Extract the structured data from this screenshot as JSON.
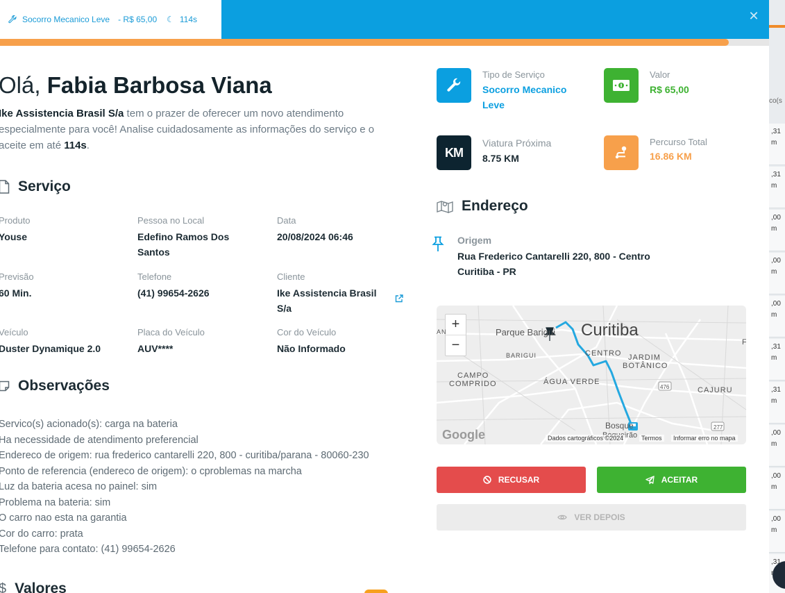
{
  "colors": {
    "primary": "#0b9fe0",
    "accent_orange": "#f7a04b",
    "success": "#3eb232",
    "danger": "#e44c4c",
    "dark": "#0d2430",
    "text": "#1c2b33",
    "muted": "#8a949b"
  },
  "top_tab": {
    "icon": "wrench-icon",
    "service": "Socorro Mecanico Leve",
    "price": "- R$ 65,00",
    "timer": "114s"
  },
  "progress": {
    "percent": 94.8
  },
  "greeting": {
    "hello": "Olá,",
    "name": "Fabia Barbosa Viana"
  },
  "intro": {
    "company": "Ike Assistencia Brasil S/a",
    "text_before_time": " tem o prazer de oferecer um novo atendimento especialmente para você! Analise cuidadosamente as informações do serviço e o aceite em até ",
    "time": "114s",
    "text_after_time": "."
  },
  "servico": {
    "title": "Serviço",
    "fields": {
      "produto": {
        "label": "Produto",
        "value": "Youse"
      },
      "pessoa": {
        "label": "Pessoa no Local",
        "value": "Edefino Ramos Dos Santos"
      },
      "data": {
        "label": "Data",
        "value": "20/08/2024 06:46"
      },
      "previsao": {
        "label": "Previsão",
        "value": "60 Min."
      },
      "telefone": {
        "label": "Telefone",
        "value": "(41) 99654-2626"
      },
      "cliente": {
        "label": "Cliente",
        "value": "Ike Assistencia Brasil S/a"
      },
      "veiculo": {
        "label": "Veículo",
        "value": "Duster Dynamique 2.0"
      },
      "placa": {
        "label": "Placa do Veículo",
        "value": "AUV****"
      },
      "cor": {
        "label": "Cor do Veículo",
        "value": "Não Informado"
      }
    }
  },
  "observacoes": {
    "title": "Observações",
    "lines": [
      "Servico(s) acionado(s): carga na bateria",
      "Ha necessidade de atendimento preferencial",
      "Endereco de origem: rua frederico cantarelli 220, 800 - curitiba/parana - 80060-230",
      "Ponto de referencia (endereco de origem): o cproblemas na marcha",
      "Luz da bateria acesa no painel: sim",
      "Problema na bateria: sim",
      "O carro nao esta na garantia",
      "Cor do carro: prata",
      "Telefone para contato: (41) 99654-2626"
    ]
  },
  "valores": {
    "title": "Valores"
  },
  "info_cards": {
    "tipo": {
      "label": "Tipo de Serviço",
      "value": "Socorro Mecanico Leve",
      "icon": "wrench-icon"
    },
    "valor": {
      "label": "Valor",
      "value": "R$ 65,00",
      "icon": "money-icon"
    },
    "viatura": {
      "label": "Viatura Próxima",
      "value": "8.75 KM",
      "icon_text": "KM"
    },
    "percurso": {
      "label": "Percurso Total",
      "value": "16.86 KM",
      "icon": "route-icon"
    }
  },
  "endereco": {
    "title": "Endereço",
    "origem_label": "Origem",
    "origem_value": "Rua Frederico Cantarelli 220, 800 - Centro Curitiba - PR"
  },
  "map": {
    "city": "Curitiba",
    "places": {
      "parque": "Parque Barigui",
      "barigui": "BARIGUI",
      "centro": "CENTRO",
      "jardim": "JARDIM",
      "botanico": "BOTÂNICO",
      "campo1": "CAMPO",
      "campo2": "COMPRIDO",
      "agua": "ÁGUA VERDE",
      "cajuru": "CAJURU",
      "bosque": "Bosque",
      "boqueirao": "Boqueirão",
      "r476": "476",
      "r277": "277",
      "an": "AN",
      "f": "F"
    },
    "zoom_in": "+",
    "zoom_out": "−",
    "google": "Google",
    "attribution": "Dados cartográficos ©2024",
    "terms": "Termos",
    "report": "Informar erro no mapa"
  },
  "actions": {
    "refuse": "RECUSAR",
    "accept": "ACEITAR",
    "later": "VER DEPOIS"
  },
  "background_page": {
    "header": "co(s",
    "values": [
      ",31",
      ",31",
      ",00",
      ",00",
      ",00",
      ",31",
      ",31",
      ",00",
      ",00",
      ",00",
      ",31"
    ],
    "sub": "m"
  }
}
